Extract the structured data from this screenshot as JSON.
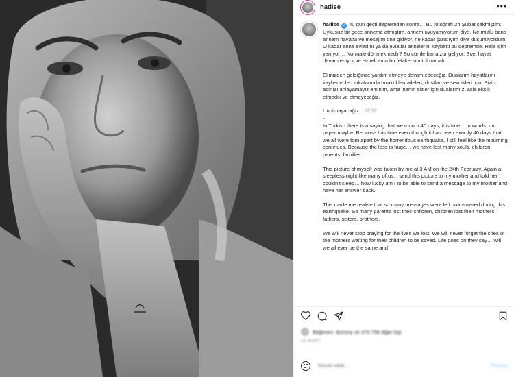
{
  "post": {
    "username": "hadise",
    "more_icon": "more-horizontal-icon"
  },
  "photo": {
    "alt": "black and white selfie of a woman resting her cheek on her hand"
  },
  "caption": {
    "username": "hadise",
    "paragraphs": [
      "40 gün geçti depremden sonra… Bu fotoğrafı 24 Şubat çekmiştim. Uykusuz bir gece anneme atmıştım, annem uyuyamıyorum diye. Ne mutlu bana annem hayatta ve mesajım ona gidiyor, ne kadar şanslıyım diye düşünüyordum. O kadar anne evladını ya da evlatlar annelerini kaybetti bu depremde. Hala içim yanıyor… Normale dönmek nedir? Bu cümle bana zor geliyor. Evet hayat devam ediyor ve etmeli ama bu felaket unutulmamalı.",
      "Elimizden geldiğince yardım etmeye devam edeceğiz. Dualarım hayatlarını kaybedenler, arkalarında bıraktıkları aileleri, dostları ve sevdikleri için. Sizin acınızı anlayamayız eminim, ama inanın sizler için dualarımızı asla eksik etmedik ve etmeyeceğiz.",
      "Unutmayacağız…🤍🤍",
      "-",
      "In Turkish there is a saying that we mourn 40 days, it is true… in words, on paper maybe. Because this time even though it has been exactly 40 days that we all were torn apart by the horrendous earthquake, I still feel like the mourning continues. Because the loss is huge… we have lost many souls, children, parents, families…",
      "This picture of myself was taken by me at 3 AM on the 24th February. Again a sleepless night like many of us. I send this picture to my mother and told her I couldn't sleep… how lucky am I to be able to send a message to my mother and have her answer back.",
      "This made me realise that so many messages were left unanswered during this earthquake. So many parents lost their children, children lost their mothers, fathers, sisters, brothers.",
      "We will never stop praying for the lives we lost. We will never forget the cries of the mothers waiting for their children to be saved. Life goes on they say… will we all ever be the same and"
    ]
  },
  "actions": {
    "like_icon": "heart-icon",
    "comment_icon": "comment-icon",
    "share_icon": "send-icon",
    "save_icon": "bookmark-icon"
  },
  "likes": {
    "text": "Beğenen: dummy ve 470.758 diğer kişi"
  },
  "date": {
    "text": "16 MART"
  },
  "comment": {
    "emoji_icon": "emoji-icon",
    "placeholder": "Yorum ekle...",
    "post_label": "Paylaş"
  }
}
